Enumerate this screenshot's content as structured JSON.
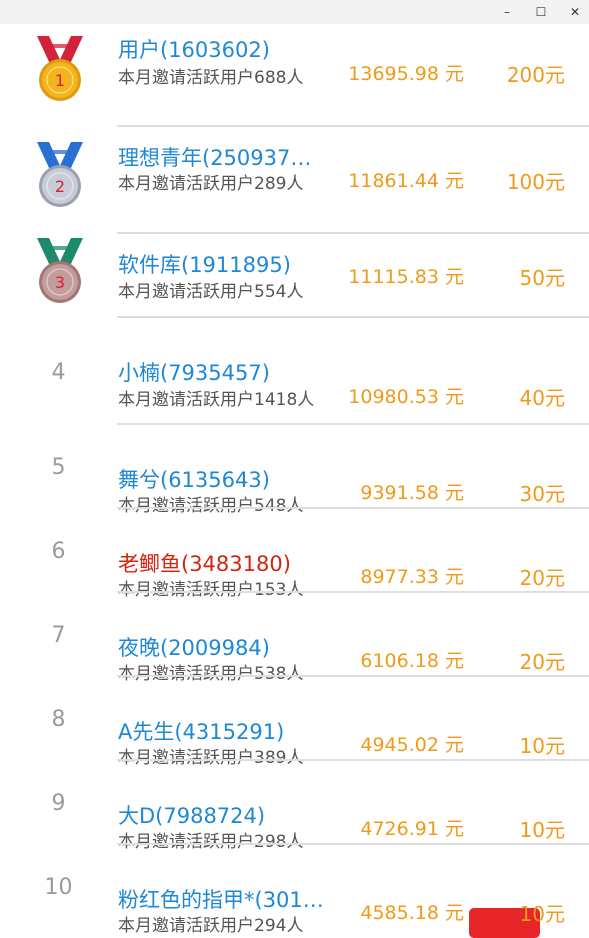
{
  "window": {
    "min_glyph": "–",
    "max_glyph": "☐",
    "close_glyph": "✕"
  },
  "leaderboard": {
    "rows": [
      {
        "rank": "1",
        "name": "用户(1603602)",
        "sub": "本月邀请活跃用户688人",
        "amount": "13695.98 元",
        "reward": "200元"
      },
      {
        "rank": "2",
        "name": "理想青年(250937…",
        "sub": "本月邀请活跃用户289人",
        "amount": "11861.44 元",
        "reward": "100元"
      },
      {
        "rank": "3",
        "name": "软件库(1911895)",
        "sub": "本月邀请活跃用户554人",
        "amount": "11115.83 元",
        "reward": "50元"
      },
      {
        "rank": "4",
        "name": "小楠(7935457)",
        "sub": "本月邀请活跃用户1418人",
        "amount": "10980.53 元",
        "reward": "40元"
      },
      {
        "rank": "5",
        "name": "舞兮(6135643)",
        "sub": "本月邀请活跃用户548人",
        "amount": "9391.58 元",
        "reward": "30元"
      },
      {
        "rank": "6",
        "name": "老鲫鱼(3483180)",
        "sub": "本月邀请活跃用户153人",
        "amount": "8977.33 元",
        "reward": "20元"
      },
      {
        "rank": "7",
        "name": "夜晚(2009984)",
        "sub": "本月邀请活跃用户538人",
        "amount": "6106.18 元",
        "reward": "20元"
      },
      {
        "rank": "8",
        "name": "A先生(4315291)",
        "sub": "本月邀请活跃用户389人",
        "amount": "4945.02 元",
        "reward": "10元"
      },
      {
        "rank": "9",
        "name": "大D(7988724)",
        "sub": "本月邀请活跃用户298人",
        "amount": "4726.91 元",
        "reward": "10元"
      },
      {
        "rank": "10",
        "name": "粉红色的指甲*(301…",
        "sub": "本月邀请活跃用户294人",
        "amount": "4585.18 元",
        "reward": "10元"
      }
    ]
  },
  "colors": {
    "name_blue": "#1e88d6",
    "name_red": "#d5240f",
    "amount_orange": "#f09a1a",
    "rank_gray": "#9a9a9a",
    "gold": "#f2b51b",
    "silver": "#c8ccd6",
    "bronze": "#c39c9c"
  }
}
